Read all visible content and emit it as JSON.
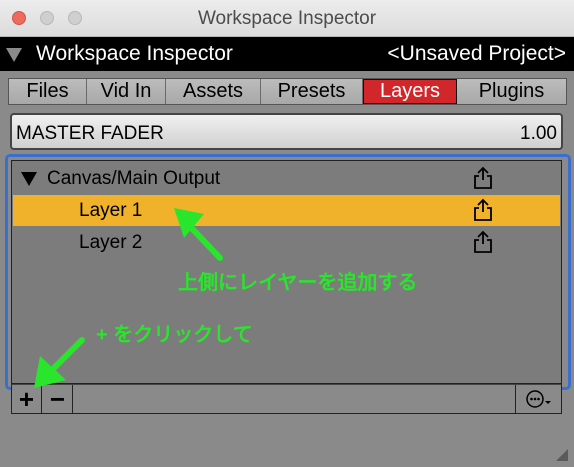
{
  "window": {
    "title": "Workspace Inspector"
  },
  "header": {
    "title": "Workspace Inspector",
    "project": "<Unsaved Project>"
  },
  "tabs": [
    {
      "label": "Files",
      "active": false
    },
    {
      "label": "Vid In",
      "active": false
    },
    {
      "label": "Assets",
      "active": false
    },
    {
      "label": "Presets",
      "active": false
    },
    {
      "label": "Layers",
      "active": true
    },
    {
      "label": "Plugins",
      "active": false
    }
  ],
  "fader": {
    "label": "MASTER FADER",
    "value": "1.00"
  },
  "layers": {
    "group": "Canvas/Main Output",
    "items": [
      {
        "label": "Layer 1",
        "selected": true
      },
      {
        "label": "Layer 2",
        "selected": false
      }
    ]
  },
  "toolbar": {
    "add": "+",
    "remove": "−"
  },
  "annotations": {
    "note1": "上側にレイヤーを追加する",
    "note2": "+ をクリックして"
  },
  "colors": {
    "active_tab": "#d1262a",
    "selected_row": "#f0b22b",
    "focus_ring": "#3a6fd0",
    "annotation": "#29e52b"
  },
  "icons": {
    "row_action": "share-icon",
    "more": "ellipsis-circle-icon"
  }
}
